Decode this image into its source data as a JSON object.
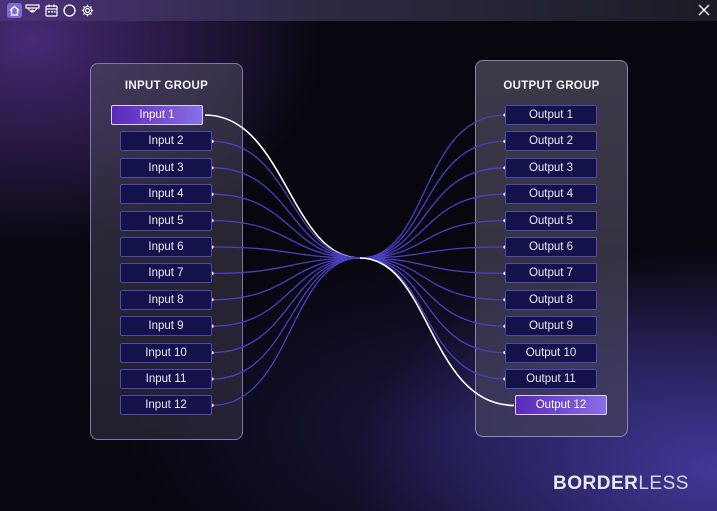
{
  "toolbar": {
    "icons": [
      "home-icon",
      "display-icon",
      "calendar-icon",
      "record-icon",
      "gear-icon"
    ],
    "close_icon": "close-icon"
  },
  "input_group": {
    "title": "INPUT GROUP",
    "items": [
      "Input 1",
      "Input 2",
      "Input 3",
      "Input 4",
      "Input 5",
      "Input 6",
      "Input 7",
      "Input 8",
      "Input 9",
      "Input 10",
      "Input 11",
      "Input 12"
    ],
    "selected_index": 0
  },
  "output_group": {
    "title": "OUTPUT GROUP",
    "items": [
      "Output 1",
      "Output 2",
      "Output 3",
      "Output 4",
      "Output 5",
      "Output 6",
      "Output 7",
      "Output 8",
      "Output 9",
      "Output 10",
      "Output 11",
      "Output 12"
    ],
    "selected_index": 11
  },
  "brand": {
    "bold_part": "BORDER",
    "light_part": "LESS"
  },
  "colors": {
    "accent": "#7c6ad8",
    "chip_bg": "#14124a",
    "chip_border": "#5047b5",
    "wire": "#4a3fbf",
    "wire_active": "#ffffff",
    "selected_gradient_start": "#5a28b8",
    "selected_gradient_end": "#8a6ee8"
  }
}
